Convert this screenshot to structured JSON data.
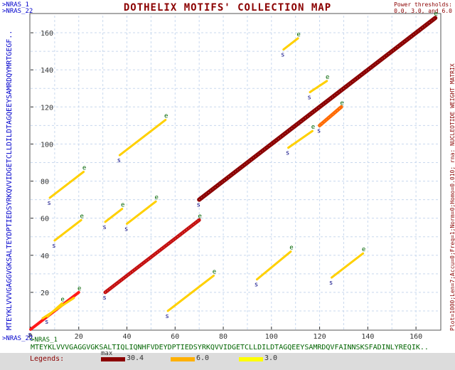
{
  "seq1_name": ">NRAS_1",
  "seq2_name": ">NRAS_22",
  "title": "DOTHELIX MOTIFS' COLLECTION MAP",
  "power_thresholds_line1": "Power thresholds:",
  "power_thresholds_line2": "0.0, 3.0, and 6.0",
  "seq_x": "MTEYKLVVVGAGGVGKSALTIQLIQNHFVDEYDPTIEDSYRKQVVIDGETCLLDILDTAGQEEYSAMRDQVFAINNSKSFADINLYREQIK..",
  "seq_y": "MTEYKLVVVGAGGVGKSALTEYDPTIEDSYRKQVVIDGETCLLDILDTAGQEEYSAMRDQYMRTGEGF..",
  "right_info": "Plot=1000;Len=7;Accu=0;Freq=1;Norm=0;Homo=0.010; rna: NUCLEOTIDE WEIGHT MATRIX",
  "legends_label": "Legends:",
  "legend_max_label": "max",
  "legend": [
    {
      "label": "30.4",
      "color": "#8b0000"
    },
    {
      "label": "6.0",
      "color": "#ffb000"
    },
    {
      "label": "3.0",
      "color": "#ffff00"
    }
  ],
  "chart_data": {
    "type": "scatter",
    "xlim": [
      0,
      170
    ],
    "ylim": [
      0,
      170
    ],
    "x_ticks": [
      0,
      20,
      40,
      60,
      80,
      100,
      120,
      140,
      160
    ],
    "y_ticks": [
      20,
      40,
      60,
      80,
      100,
      120,
      140,
      160
    ],
    "start_marker": "s",
    "end_marker": "e",
    "segments": [
      {
        "x0": 0,
        "y0": 0,
        "x1": 20,
        "y1": 20,
        "color": "#ff1a1a",
        "width": 4,
        "s": true,
        "e": true
      },
      {
        "x0": 7,
        "y0": 7,
        "x1": 13,
        "y1": 14,
        "color": "#ffd000",
        "width": 3,
        "s": true,
        "e": true
      },
      {
        "x0": 5,
        "y0": 6,
        "x1": 18,
        "y1": 17,
        "color": "#ffd000",
        "width": 3,
        "s": false,
        "e": false
      },
      {
        "x0": 31,
        "y0": 20,
        "x1": 70,
        "y1": 59,
        "color": "#c41010",
        "width": 5,
        "s": true,
        "e": true
      },
      {
        "x0": 70,
        "y0": 70,
        "x1": 168,
        "y1": 168,
        "color": "#8b0000",
        "width": 6,
        "s": true,
        "e": true
      },
      {
        "x0": 120,
        "y0": 110,
        "x1": 129,
        "y1": 120,
        "color": "#ff6a00",
        "width": 5,
        "s": true,
        "e": true
      },
      {
        "x0": 8,
        "y0": 71,
        "x1": 22,
        "y1": 85,
        "color": "#ffd000",
        "width": 3,
        "s": true,
        "e": true
      },
      {
        "x0": 10,
        "y0": 48,
        "x1": 21,
        "y1": 59,
        "color": "#ffd000",
        "width": 3,
        "s": true,
        "e": true
      },
      {
        "x0": 31,
        "y0": 58,
        "x1": 38,
        "y1": 65,
        "color": "#ffd000",
        "width": 3,
        "s": true,
        "e": true
      },
      {
        "x0": 40,
        "y0": 57,
        "x1": 52,
        "y1": 69,
        "color": "#ffd000",
        "width": 3,
        "s": true,
        "e": true
      },
      {
        "x0": 37,
        "y0": 94,
        "x1": 56,
        "y1": 113,
        "color": "#ffd000",
        "width": 3,
        "s": true,
        "e": true
      },
      {
        "x0": 57,
        "y0": 10,
        "x1": 76,
        "y1": 29,
        "color": "#ffd000",
        "width": 3,
        "s": true,
        "e": true
      },
      {
        "x0": 94,
        "y0": 27,
        "x1": 108,
        "y1": 42,
        "color": "#ffd000",
        "width": 3,
        "s": true,
        "e": true
      },
      {
        "x0": 107,
        "y0": 98,
        "x1": 117,
        "y1": 107,
        "color": "#ffd000",
        "width": 3,
        "s": true,
        "e": true
      },
      {
        "x0": 105,
        "y0": 151,
        "x1": 111,
        "y1": 157,
        "color": "#ffd000",
        "width": 3,
        "s": true,
        "e": true
      },
      {
        "x0": 116,
        "y0": 128,
        "x1": 123,
        "y1": 134,
        "color": "#ffd000",
        "width": 3,
        "s": true,
        "e": true
      },
      {
        "x0": 125,
        "y0": 28,
        "x1": 138,
        "y1": 41,
        "color": "#ffd000",
        "width": 3,
        "s": true,
        "e": true
      }
    ]
  }
}
